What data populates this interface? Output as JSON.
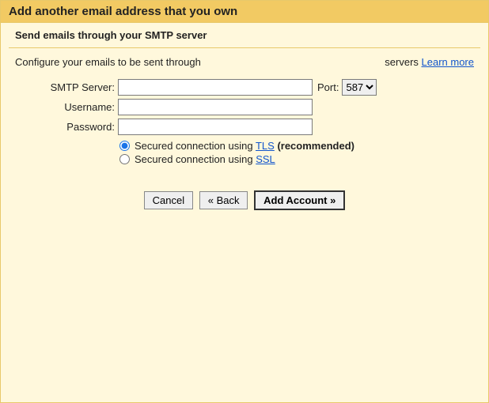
{
  "header": {
    "title": "Add another email address that you own"
  },
  "subtitle": "Send emails through your SMTP server",
  "config_line": {
    "prefix": "Configure your emails to be sent through",
    "suffix_text": "servers ",
    "learn_more": "Learn more"
  },
  "fields": {
    "smtp_server_label": "SMTP Server:",
    "smtp_server_value": "",
    "port_label": "Port:",
    "port_value": "587",
    "username_label": "Username:",
    "username_value": "",
    "password_label": "Password:",
    "password_value": ""
  },
  "security": {
    "tls_prefix": "Secured connection using ",
    "tls_link": "TLS",
    "tls_suffix": " (recommended)",
    "ssl_prefix": "Secured connection using ",
    "ssl_link": "SSL"
  },
  "buttons": {
    "cancel": "Cancel",
    "back": "« Back",
    "add_account": "Add Account »"
  }
}
